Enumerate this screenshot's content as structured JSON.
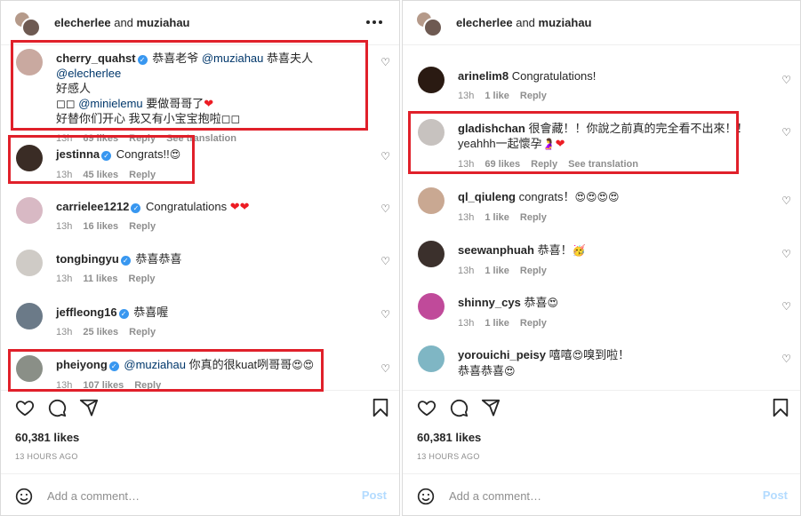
{
  "left": {
    "header": {
      "user1": "elecherlee",
      "joiner": " and ",
      "user2": "muziahau"
    },
    "comments": [
      {
        "user": "cherry_quahst",
        "verified": true,
        "mention1": "@muziahau",
        "text1": " 恭喜老爷 ",
        "text2": " 恭喜夫人 ",
        "mention2": "@elecherlee",
        "line2": "好感人",
        "line3a": "◻◻ ",
        "mention3": "@minielemu",
        "line3b": " 要做哥哥了",
        "line4": "好替你们开心 我又有小宝宝抱啦◻◻",
        "time": "13h",
        "likes": "69 likes",
        "reply": "Reply",
        "translate": "See translation"
      },
      {
        "user": "jestinna",
        "verified": true,
        "text": "Congrats!!",
        "time": "13h",
        "likes": "45 likes",
        "reply": "Reply"
      },
      {
        "user": "carrielee1212",
        "verified": true,
        "text": "Congratulations",
        "time": "13h",
        "likes": "16 likes",
        "reply": "Reply"
      },
      {
        "user": "tongbingyu",
        "verified": true,
        "text": "恭喜恭喜",
        "time": "13h",
        "likes": "11 likes",
        "reply": "Reply"
      },
      {
        "user": "jeffleong16",
        "verified": true,
        "text": "恭喜喔",
        "time": "13h",
        "likes": "25 likes",
        "reply": "Reply"
      },
      {
        "user": "pheiyong",
        "verified": true,
        "mention": "@muziahau",
        "text": " 你真的很kuat咧哥哥",
        "time": "13h",
        "likes": "107 likes",
        "reply": "Reply"
      }
    ],
    "likes_count": "60,381 likes",
    "ago": "13 HOURS AGO",
    "add_placeholder": "Add a comment…",
    "post": "Post"
  },
  "right": {
    "header": {
      "user1": "elecherlee",
      "joiner": " and ",
      "user2": "muziahau"
    },
    "comments": [
      {
        "user": "arinelim8",
        "text": "Congratulations!",
        "time": "13h",
        "likes": "1 like",
        "reply": "Reply"
      },
      {
        "user": "gladishchan",
        "text": "很會藏！！你說之前真的完全看不出來！！",
        "line2": "yeahhh一起懷孕",
        "time": "13h",
        "likes": "69 likes",
        "reply": "Reply",
        "translate": "See translation"
      },
      {
        "user": "ql_qiuleng",
        "text": "congrats！",
        "time": "13h",
        "likes": "1 like",
        "reply": "Reply"
      },
      {
        "user": "seewanphuah",
        "text": "恭喜！",
        "time": "13h",
        "likes": "1 like",
        "reply": "Reply"
      },
      {
        "user": "shinny_cys",
        "text": "恭喜",
        "time": "13h",
        "likes": "1 like",
        "reply": "Reply"
      },
      {
        "user": "yorouichi_peisy",
        "text": "嘻嘻",
        "text2": "嗅到啦！",
        "line2": "恭喜恭喜"
      }
    ],
    "likes_count": "60,381 likes",
    "ago": "13 HOURS AGO",
    "add_placeholder": "Add a comment…",
    "post": "Post"
  },
  "colors": {
    "highlight": "#e0202a",
    "mention": "#00376b",
    "verified": "#3897f0",
    "heart": "#ed1c24"
  },
  "icons": [
    "heart-icon",
    "comment-icon",
    "share-icon",
    "bookmark-icon",
    "smiley-icon",
    "more-icon",
    "verified-icon"
  ]
}
